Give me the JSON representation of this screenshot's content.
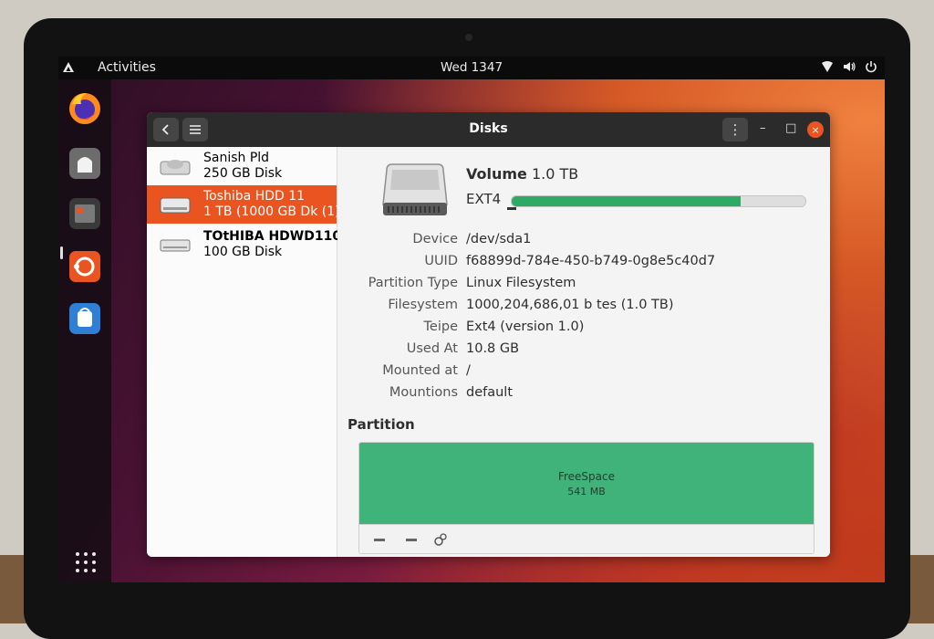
{
  "topbar": {
    "activities": "Activities",
    "clock": "Wed 1347"
  },
  "dock": {
    "items": [
      "firefox",
      "files-app",
      "folder-app",
      "ubuntu-software",
      "app-store"
    ]
  },
  "window": {
    "title": "Disks",
    "close_glyph": "×",
    "menu_glyph": "⋮",
    "minimize_glyph": "–",
    "maximize_glyph": "□"
  },
  "sidebar": {
    "disks": [
      {
        "name": "Sanish Pld",
        "sub": "250 GB Disk"
      },
      {
        "name": "Toshiba HDD 11",
        "sub": "1 TB  (1000 GB Dk (1)"
      },
      {
        "name": "TOtHIBA HDWD110",
        "sub": "100 GB Disk"
      }
    ]
  },
  "volume": {
    "title_bold": "Volume",
    "title_size": "1.0 TB",
    "fs": "EXT4",
    "usage_fraction": 0.78
  },
  "properties": [
    {
      "label": "Device",
      "value": "/dev/sda1"
    },
    {
      "label": "UUID",
      "value": "f68899d-784e-450-b749-0g8e5c40d7"
    },
    {
      "label": "Partition Type",
      "value": "Linux Filesystem"
    },
    {
      "label": "Filesystem",
      "value": "1000,204,686,01 b tes (1.0 TB)"
    },
    {
      "label": "Teipe",
      "value": "Ext4 (version 1.0)"
    },
    {
      "label": "Used  At",
      "value": "10.8 GB"
    },
    {
      "label": "Mounted at",
      "value": "/"
    },
    {
      "label": "Mountions",
      "value": "default"
    }
  ],
  "partition": {
    "heading": "Partition",
    "free_label": "FreeSpace",
    "free_size": "541 MB"
  },
  "colors": {
    "accent": "#e95420",
    "usage": "#2eaa64",
    "free_space": "#3fb37a"
  }
}
